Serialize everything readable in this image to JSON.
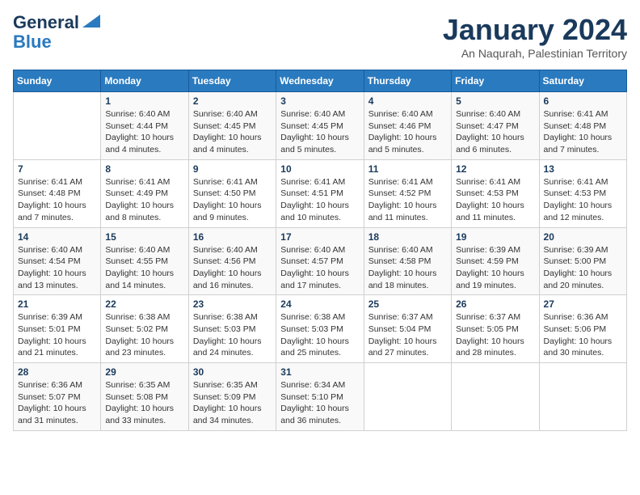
{
  "header": {
    "logo_general": "General",
    "logo_blue": "Blue",
    "month_title": "January 2024",
    "subtitle": "An Naqurah, Palestinian Territory"
  },
  "weekdays": [
    "Sunday",
    "Monday",
    "Tuesday",
    "Wednesday",
    "Thursday",
    "Friday",
    "Saturday"
  ],
  "weeks": [
    [
      {
        "day": "",
        "info": ""
      },
      {
        "day": "1",
        "info": "Sunrise: 6:40 AM\nSunset: 4:44 PM\nDaylight: 10 hours\nand 4 minutes."
      },
      {
        "day": "2",
        "info": "Sunrise: 6:40 AM\nSunset: 4:45 PM\nDaylight: 10 hours\nand 4 minutes."
      },
      {
        "day": "3",
        "info": "Sunrise: 6:40 AM\nSunset: 4:45 PM\nDaylight: 10 hours\nand 5 minutes."
      },
      {
        "day": "4",
        "info": "Sunrise: 6:40 AM\nSunset: 4:46 PM\nDaylight: 10 hours\nand 5 minutes."
      },
      {
        "day": "5",
        "info": "Sunrise: 6:40 AM\nSunset: 4:47 PM\nDaylight: 10 hours\nand 6 minutes."
      },
      {
        "day": "6",
        "info": "Sunrise: 6:41 AM\nSunset: 4:48 PM\nDaylight: 10 hours\nand 7 minutes."
      }
    ],
    [
      {
        "day": "7",
        "info": "Sunrise: 6:41 AM\nSunset: 4:48 PM\nDaylight: 10 hours\nand 7 minutes."
      },
      {
        "day": "8",
        "info": "Sunrise: 6:41 AM\nSunset: 4:49 PM\nDaylight: 10 hours\nand 8 minutes."
      },
      {
        "day": "9",
        "info": "Sunrise: 6:41 AM\nSunset: 4:50 PM\nDaylight: 10 hours\nand 9 minutes."
      },
      {
        "day": "10",
        "info": "Sunrise: 6:41 AM\nSunset: 4:51 PM\nDaylight: 10 hours\nand 10 minutes."
      },
      {
        "day": "11",
        "info": "Sunrise: 6:41 AM\nSunset: 4:52 PM\nDaylight: 10 hours\nand 11 minutes."
      },
      {
        "day": "12",
        "info": "Sunrise: 6:41 AM\nSunset: 4:53 PM\nDaylight: 10 hours\nand 11 minutes."
      },
      {
        "day": "13",
        "info": "Sunrise: 6:41 AM\nSunset: 4:53 PM\nDaylight: 10 hours\nand 12 minutes."
      }
    ],
    [
      {
        "day": "14",
        "info": "Sunrise: 6:40 AM\nSunset: 4:54 PM\nDaylight: 10 hours\nand 13 minutes."
      },
      {
        "day": "15",
        "info": "Sunrise: 6:40 AM\nSunset: 4:55 PM\nDaylight: 10 hours\nand 14 minutes."
      },
      {
        "day": "16",
        "info": "Sunrise: 6:40 AM\nSunset: 4:56 PM\nDaylight: 10 hours\nand 16 minutes."
      },
      {
        "day": "17",
        "info": "Sunrise: 6:40 AM\nSunset: 4:57 PM\nDaylight: 10 hours\nand 17 minutes."
      },
      {
        "day": "18",
        "info": "Sunrise: 6:40 AM\nSunset: 4:58 PM\nDaylight: 10 hours\nand 18 minutes."
      },
      {
        "day": "19",
        "info": "Sunrise: 6:39 AM\nSunset: 4:59 PM\nDaylight: 10 hours\nand 19 minutes."
      },
      {
        "day": "20",
        "info": "Sunrise: 6:39 AM\nSunset: 5:00 PM\nDaylight: 10 hours\nand 20 minutes."
      }
    ],
    [
      {
        "day": "21",
        "info": "Sunrise: 6:39 AM\nSunset: 5:01 PM\nDaylight: 10 hours\nand 21 minutes."
      },
      {
        "day": "22",
        "info": "Sunrise: 6:38 AM\nSunset: 5:02 PM\nDaylight: 10 hours\nand 23 minutes."
      },
      {
        "day": "23",
        "info": "Sunrise: 6:38 AM\nSunset: 5:03 PM\nDaylight: 10 hours\nand 24 minutes."
      },
      {
        "day": "24",
        "info": "Sunrise: 6:38 AM\nSunset: 5:03 PM\nDaylight: 10 hours\nand 25 minutes."
      },
      {
        "day": "25",
        "info": "Sunrise: 6:37 AM\nSunset: 5:04 PM\nDaylight: 10 hours\nand 27 minutes."
      },
      {
        "day": "26",
        "info": "Sunrise: 6:37 AM\nSunset: 5:05 PM\nDaylight: 10 hours\nand 28 minutes."
      },
      {
        "day": "27",
        "info": "Sunrise: 6:36 AM\nSunset: 5:06 PM\nDaylight: 10 hours\nand 30 minutes."
      }
    ],
    [
      {
        "day": "28",
        "info": "Sunrise: 6:36 AM\nSunset: 5:07 PM\nDaylight: 10 hours\nand 31 minutes."
      },
      {
        "day": "29",
        "info": "Sunrise: 6:35 AM\nSunset: 5:08 PM\nDaylight: 10 hours\nand 33 minutes."
      },
      {
        "day": "30",
        "info": "Sunrise: 6:35 AM\nSunset: 5:09 PM\nDaylight: 10 hours\nand 34 minutes."
      },
      {
        "day": "31",
        "info": "Sunrise: 6:34 AM\nSunset: 5:10 PM\nDaylight: 10 hours\nand 36 minutes."
      },
      {
        "day": "",
        "info": ""
      },
      {
        "day": "",
        "info": ""
      },
      {
        "day": "",
        "info": ""
      }
    ]
  ]
}
